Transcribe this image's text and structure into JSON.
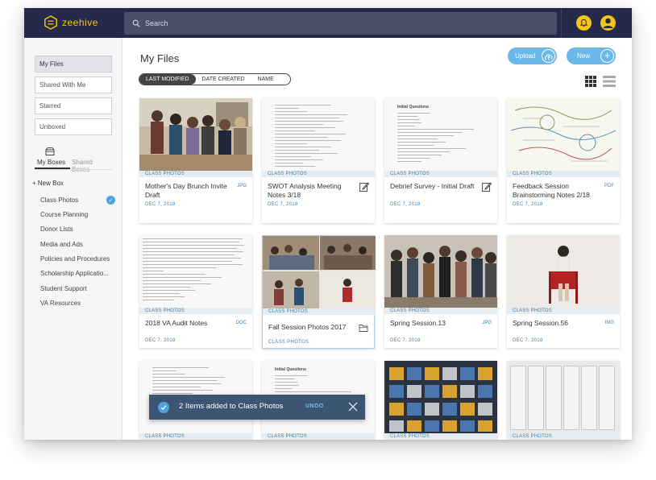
{
  "app": {
    "logo": "zeehive"
  },
  "search": {
    "placeholder": "Search"
  },
  "sidebar": {
    "nav": [
      "My Files",
      "Shared With Me",
      "Starred",
      "Unboxed"
    ],
    "box_tabs": {
      "my": "My Boxes",
      "shared": "Shared Boxes"
    },
    "new_box": "+ New Box",
    "boxes": [
      "Class Photos",
      "Course Planning",
      "Donor Lists",
      "Media and Ads",
      "Policies and Procedures",
      "Scholarship Applicatio...",
      "Student Support",
      "VA Resources"
    ]
  },
  "main": {
    "title": "My Files",
    "upload_label": "Upload",
    "new_label": "New",
    "sort": [
      "LAST MODIFIED",
      "DATE CREATED",
      "NAME"
    ]
  },
  "cards": [
    {
      "category": "CLASS PHOTOS",
      "name": "Mother's Day Brunch Invite Draft",
      "type": "JPG",
      "date": "DEC 7, 2018"
    },
    {
      "category": "CLASS PHOTOS",
      "name": "SWOT Analysis Meeting Notes 3/18",
      "type": "",
      "date": "DEC 7, 2018"
    },
    {
      "category": "CLASS PHOTOS",
      "name": "Debrief Survey - Initial Draft",
      "type": "",
      "date": "DEC 7, 2018",
      "doc_title": "Initial Questions"
    },
    {
      "category": "CLASS PHOTOS",
      "name": "Feedback Session Brainstorming Notes 2/18",
      "type": "PDF",
      "date": "DEC 7, 2018"
    },
    {
      "category": "CLASS PHOTOS",
      "name": "2018 VA Audit Notes",
      "type": "DOC",
      "date": "DEC 7, 2018"
    },
    {
      "category": "CLASS PHOTOS",
      "name": "Fall Session Photos 2017",
      "type": "",
      "date": "CLASS PHOTOS"
    },
    {
      "category": "CLASS PHOTOS",
      "name": "Spring Session.13",
      "type": "JPG",
      "date": "DEC 7, 2018"
    },
    {
      "category": "CLASS PHOTOS",
      "name": "Spring Session.56",
      "type": "IMG",
      "date": "DEC 7, 2018"
    },
    {
      "category": "CLASS PHOTOS",
      "name": "",
      "type": "",
      "date": ""
    },
    {
      "category": "CLASS PHOTOS",
      "name": "",
      "type": "",
      "date": "",
      "doc_title": "Initial Questions"
    },
    {
      "category": "CLASS PHOTOS",
      "name": "",
      "type": "",
      "date": ""
    },
    {
      "category": "CLASS PHOTOS",
      "name": "",
      "type": "",
      "date": ""
    }
  ],
  "toast": {
    "message": "2 Items added to Class Photos",
    "undo": "UNDO"
  },
  "colors": {
    "topbar": "#252a4a",
    "accent": "#f5c518",
    "link": "#3f7fa8",
    "button": "#6bb8e8"
  }
}
